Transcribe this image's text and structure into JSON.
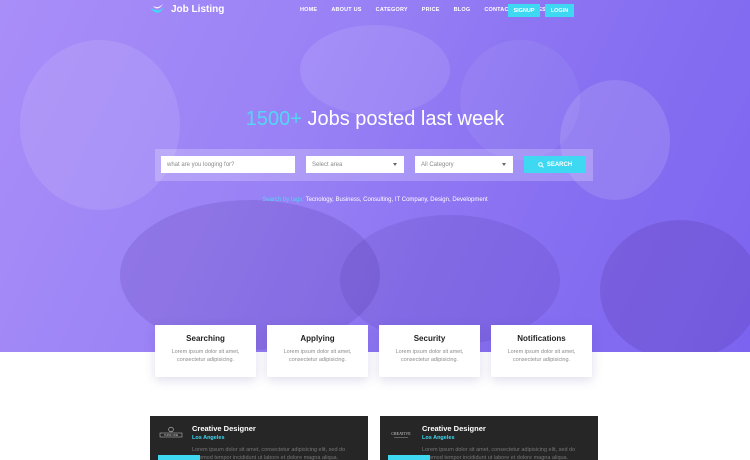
{
  "brand": {
    "name": "Job Listing",
    "logo_icon": "wave-logo-icon"
  },
  "nav": {
    "links": [
      "HOME",
      "ABOUT US",
      "CATEGORY",
      "PRICE",
      "BLOG",
      "CONTACT",
      "PAGES"
    ],
    "signup": "SIGNUP",
    "login": "LOGIN"
  },
  "hero": {
    "count": "1500+",
    "headline": "Jobs posted last week"
  },
  "search": {
    "keyword_placeholder": "what are you looging for?",
    "area_placeholder": "Select area",
    "category_placeholder": "All Category",
    "button_label": "SEARCH",
    "tags_label": "Search by tags:",
    "tags": "Tecnology, Business, Consulting, IT Company, Design, Development"
  },
  "features": [
    {
      "title": "Searching",
      "text": "Lorem ipsum dolor sit amet, consectetur adipisicing."
    },
    {
      "title": "Applying",
      "text": "Lorem ipsum dolor sit amet, consectetur adipisicing."
    },
    {
      "title": "Security",
      "text": "Lorem ipsum dolor sit amet, consectetur adipisicing."
    },
    {
      "title": "Notifications",
      "text": "Lorem ipsum dolor sit amet, consectetur adipisicing."
    }
  ],
  "jobs": [
    {
      "title": "Creative Designer",
      "location": "Los Angeles",
      "logo_text": "THINK ONE",
      "description": "Lorem ipsum dolor sit amet, consectetur adipisicing elit, sed do eiusmod tempor incididunt ut labore et dolore magna aliqua."
    },
    {
      "title": "Creative Designer",
      "location": "Los Angeles",
      "logo_text": "CREATIVE",
      "description": "Lorem ipsum dolor sit amet, consectetur adipisicing elit, sed do eiusmod tempor incididunt ut labore et dolore magna aliqua."
    }
  ],
  "colors": {
    "accent": "#3fd8f3",
    "hero_start": "#a98ef8",
    "hero_end": "#7c64f0",
    "job_card_bg": "#262626"
  }
}
